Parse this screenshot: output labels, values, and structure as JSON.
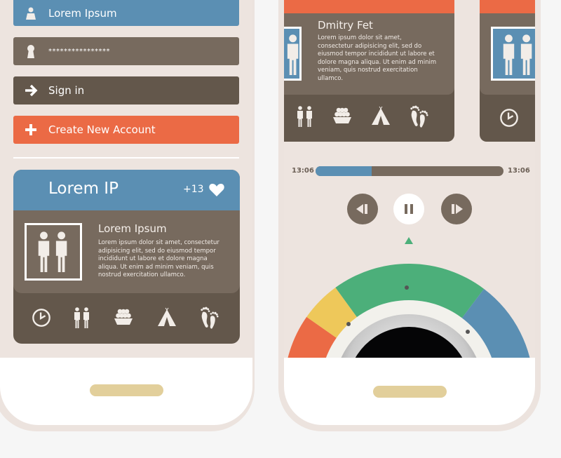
{
  "login": {
    "username": "Lorem Ipsum",
    "password": "****************",
    "signin": "Sign in",
    "create": "Create New Account"
  },
  "card": {
    "title": "Lorem IP",
    "count": "+13",
    "subtitle": "Lorem Ipsum",
    "body": "Lorem ipsum dolor sit amet, consectetur adipisicing elit, sed do eiusmod tempor incididunt ut labore et dolore magna aliqua. Ut enim ad minim veniam, quis nostrud exercitation ullamco."
  },
  "profile": {
    "name": "Dmitry Fet",
    "body": "Lorem ipsum dolor sit amet, consectetur adipisicing elit, sed do eiusmod tempor incididunt ut labore et dolore magna aliqua. Ut enim ad minim veniam, quis nostrud exercitation ullamco."
  },
  "player": {
    "elapsed": "13:06",
    "total": "13:06",
    "progress_percent": 30
  },
  "colors": {
    "blue": "#5b8fb3",
    "brown": "#776a5e",
    "dark_brown": "#63574b",
    "orange": "#eb6a45",
    "green": "#4caf7a",
    "yellow": "#eec85a"
  }
}
